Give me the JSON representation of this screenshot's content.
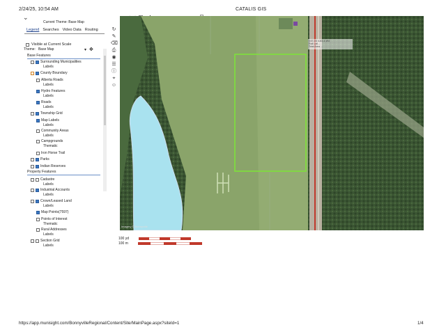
{
  "header": {
    "datetime": "2/24/25, 10:54 AM",
    "title": "CATALIS GIS"
  },
  "panel": {
    "collapse_icon": "chevrons-down-icon",
    "current_theme": "Current Theme: Base Map",
    "tabs": [
      "Legend",
      "Searches",
      "Video Data",
      "Routing"
    ],
    "visible_label": "Visible at Current Scale",
    "theme_label": "Theme:",
    "theme_value": "Base Map",
    "sections": [
      {
        "title": "Base Features"
      },
      {
        "title": "Property Features"
      }
    ],
    "items": [
      {
        "label": "Surrounding Municipalities",
        "sub": "Labels"
      },
      {
        "label": "County Boundary"
      },
      {
        "label": "Alberta Roads",
        "sub": "Labels"
      },
      {
        "label": "Hydro Features",
        "sub": "Labels"
      },
      {
        "label": "Roads",
        "sub": "Labels"
      },
      {
        "label": "Township Grid"
      },
      {
        "label": "Map Labels",
        "sub": "Labels"
      },
      {
        "label": "Community Areas",
        "sub": "Labels"
      },
      {
        "label": "Campgrounds",
        "sub": "Thematic"
      },
      {
        "label": "Iron Horse Trail"
      },
      {
        "label": "Parks"
      },
      {
        "label": "Indian Reserves"
      },
      {
        "label": "Cadastre",
        "sub": "Labels"
      },
      {
        "label": "Industrial Accounts",
        "sub": "Labels"
      },
      {
        "label": "Crown/Leased Land",
        "sub": "Labels"
      },
      {
        "label": "Map Points(7597)"
      },
      {
        "label": "Points of Interest",
        "sub": "Thematic"
      },
      {
        "label": "Rural Addresses",
        "sub": "Labels"
      },
      {
        "label": "Section Grid",
        "sub": "Labels"
      }
    ]
  },
  "map": {
    "popup_lines": [
      "N.E.1/4 4-63-4-W4",
      "Roll Lot/...",
      "Total Area ..."
    ],
    "attribution": "Imagery © Bonnyville",
    "scale_labels": [
      "100 yd",
      "100 m"
    ]
  },
  "footer": {
    "url": "https://app.munisight.com/BonnyvilleRegional/Content/Site/MainPage.aspx?siteId=1",
    "page": "1/4"
  }
}
